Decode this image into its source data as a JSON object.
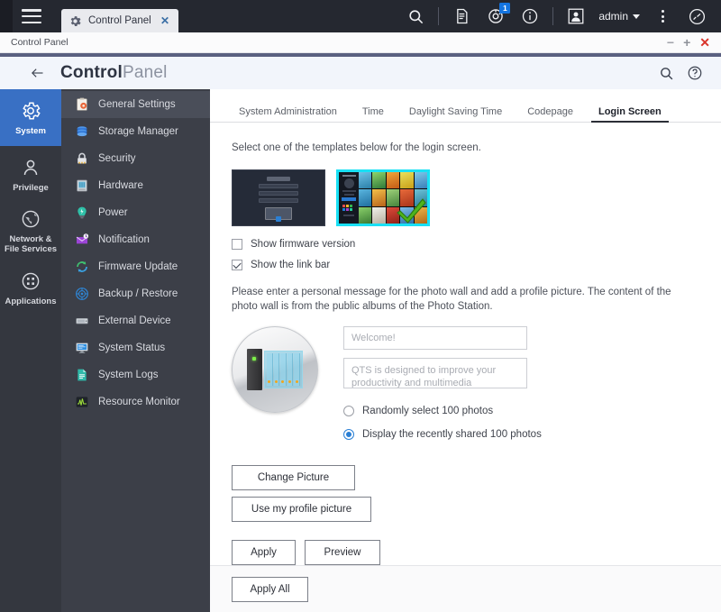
{
  "desktop": {
    "menu_icon": "hamburger-icon",
    "tab": {
      "icon": "gear-icon",
      "title": "Control Panel",
      "close": "✕"
    },
    "icons": [
      {
        "name": "search-icon",
        "label": "Search"
      },
      {
        "name": "file-station-icon",
        "label": "File Station"
      },
      {
        "name": "notification-icon",
        "label": "Notifications",
        "badge": "1"
      },
      {
        "name": "info-icon",
        "label": "Information"
      },
      {
        "name": "user-avatar-icon",
        "label": "User"
      }
    ],
    "user": "admin",
    "more_icon": "more-vertical-icon",
    "dashboard_icon": "dashboard-icon"
  },
  "window": {
    "title": "Control Panel",
    "minimize": "−",
    "maximize": "+",
    "close": "✕"
  },
  "cp_header": {
    "back_icon": "back-arrow-icon",
    "title_bold": "Control",
    "title_light": "Panel",
    "search_icon": "search-icon",
    "help_icon": "help-icon"
  },
  "rail": {
    "items": [
      {
        "label": "System",
        "icon": "gear-icon",
        "active": true
      },
      {
        "label": "Privilege",
        "icon": "user-icon",
        "active": false
      },
      {
        "label": "Network &\nFile Services",
        "icon": "globe-icon",
        "active": false
      },
      {
        "label": "Applications",
        "icon": "grid-icon",
        "active": false
      }
    ]
  },
  "menu": {
    "items": [
      {
        "label": "General Settings",
        "icon": "clipboard-gear-icon",
        "active": true
      },
      {
        "label": "Storage Manager",
        "icon": "database-icon",
        "active": false
      },
      {
        "label": "Security",
        "icon": "lock-icon",
        "active": false
      },
      {
        "label": "Hardware",
        "icon": "hardware-icon",
        "active": false
      },
      {
        "label": "Power",
        "icon": "power-icon",
        "active": false
      },
      {
        "label": "Notification",
        "icon": "notification-icon",
        "active": false
      },
      {
        "label": "Firmware Update",
        "icon": "refresh-icon",
        "active": false
      },
      {
        "label": "Backup / Restore",
        "icon": "backup-icon",
        "active": false
      },
      {
        "label": "External Device",
        "icon": "external-device-icon",
        "active": false
      },
      {
        "label": "System Status",
        "icon": "monitor-icon",
        "active": false
      },
      {
        "label": "System Logs",
        "icon": "log-icon",
        "active": false
      },
      {
        "label": "Resource Monitor",
        "icon": "chart-icon",
        "active": false
      }
    ]
  },
  "tabs": [
    {
      "label": "System Administration",
      "active": false
    },
    {
      "label": "Time",
      "active": false
    },
    {
      "label": "Daylight Saving Time",
      "active": false
    },
    {
      "label": "Codepage",
      "active": false
    },
    {
      "label": "Login Screen",
      "active": true
    }
  ],
  "main": {
    "hint": "Select one of the templates below for the login screen.",
    "templates": [
      {
        "name": "classic-login-template",
        "selected": false
      },
      {
        "name": "photo-wall-template",
        "selected": true
      }
    ],
    "checkboxes": [
      {
        "label": "Show firmware version",
        "checked": false
      },
      {
        "label": "Show the link bar",
        "checked": true
      }
    ],
    "paragraph": "Please enter a personal message for the photo wall and add a profile picture. The content of the photo wall is from the public albums of the Photo Station.",
    "avatar_icon": "nas-device-avatar",
    "fields": {
      "title": {
        "value": "",
        "placeholder": "Welcome!"
      },
      "message": {
        "value": "",
        "placeholder": "QTS is designed to improve your productivity and multimedia experience."
      }
    },
    "radios": [
      {
        "label": "Randomly select 100 photos",
        "selected": false
      },
      {
        "label": "Display the recently shared 100 photos",
        "selected": true
      }
    ],
    "buttons": {
      "change_picture": "Change Picture",
      "use_profile_picture": "Use my profile picture",
      "apply": "Apply",
      "preview": "Preview"
    }
  },
  "footer": {
    "apply_all": "Apply All"
  },
  "colors": {
    "accent_blue": "#3970c4",
    "badge_blue": "#1474e0",
    "selection_cyan": "#19e0f5",
    "topbar_dark": "#252830",
    "menu_dark": "#3c3f48",
    "rail_dark": "#34373f",
    "close_red": "#d9342b"
  }
}
